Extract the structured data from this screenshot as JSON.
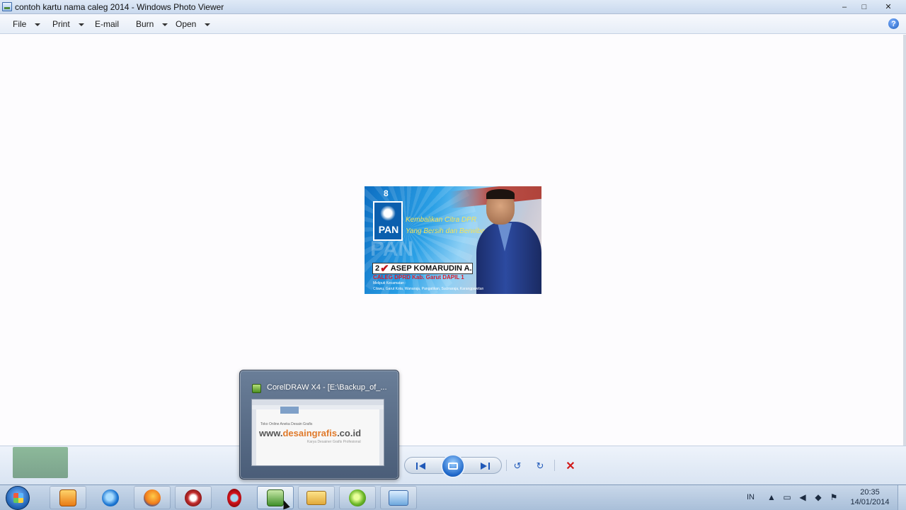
{
  "window": {
    "title": "contoh kartu nama caleg 2014 - Windows Photo Viewer",
    "minimize": "–",
    "maximize": "□",
    "close": "✕"
  },
  "menu": {
    "file": "File",
    "print": "Print",
    "email": "E-mail",
    "burn": "Burn",
    "open": "Open",
    "help": "?"
  },
  "card": {
    "number": "8",
    "party": "PAN",
    "slogan_1": "Kembalikan Citra DPR",
    "slogan_2": "Yang Bersih dan Berwibawa",
    "ballot_number": "2",
    "check": "✔",
    "candidate_name": "ASEP KOMARUDIN A.",
    "position": "CALEG DPRD Kab. Garut DAPIL 1",
    "area_label": "Meliputi Kecamatan :",
    "areas": "Cilawu, Garut Kota, Wanaraja, Pangatikan, Sucinaraja, Karangpawitan"
  },
  "popup": {
    "title": "CorelDRAW X4 - [E:\\Backup_of_...",
    "preview_line": "Toko Online Aneka Desain Grafis",
    "url_prefix": "www.",
    "url_mid": "desaingrafis",
    "url_suffix": ".co.id",
    "tagline": "Karya Desainer Grafis Profesional"
  },
  "navigation": {
    "prev_icon": "prev-icon",
    "next_icon": "next-icon",
    "rotate_left": "↺",
    "rotate_right": "↻",
    "delete": "✕"
  },
  "taskbar": {
    "items": [
      "start",
      "media-player",
      "internet-explorer",
      "firefox",
      "app-red",
      "opera",
      "coreldraw",
      "explorer",
      "app-green",
      "photo-viewer"
    ],
    "language": "IN",
    "time": "20:35",
    "date": "14/01/2014"
  }
}
